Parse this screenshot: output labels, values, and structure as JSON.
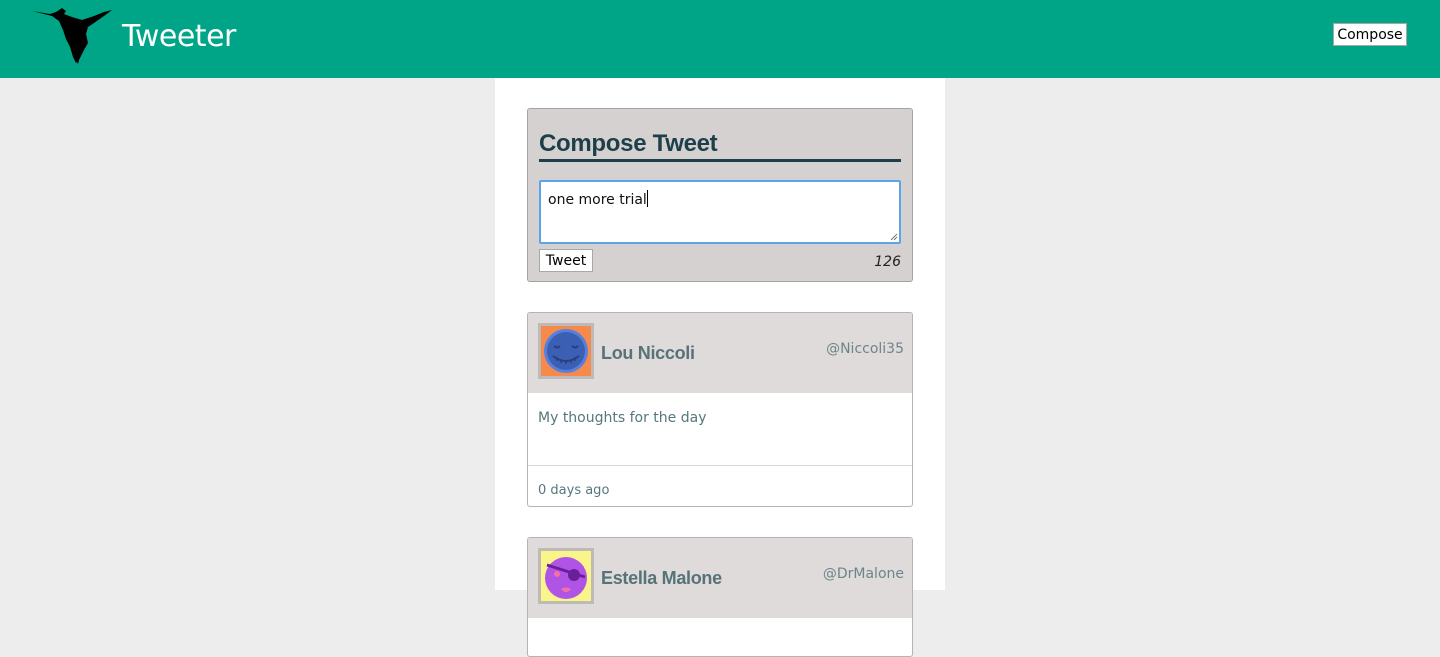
{
  "nav": {
    "logo_icon": "hummingbird-icon",
    "brand": "Tweeter",
    "compose_label": "Compose"
  },
  "compose": {
    "title": "Compose Tweet",
    "input_value": "one more trial",
    "tweet_label": "Tweet",
    "counter": "126"
  },
  "tweets": [
    {
      "name": "Lou Niccoli",
      "handle": "@Niccoli35",
      "body": "My thoughts for the day",
      "timestamp": "0 days ago",
      "avatar_colors": {
        "bg": "#f58a4b",
        "face": "#5580e0",
        "features": "#2f4d9a"
      }
    },
    {
      "name": "Estella Malone",
      "handle": "@DrMalone",
      "avatar_colors": {
        "bg": "#f9f58a",
        "face": "#b054e6",
        "features": "#f36fa6"
      }
    }
  ],
  "colors": {
    "navbar": "#00a587",
    "compose_bg": "#d5d1d0",
    "title": "#1c3f4a",
    "tweet_header": "#dedbda",
    "author": "#577378"
  }
}
